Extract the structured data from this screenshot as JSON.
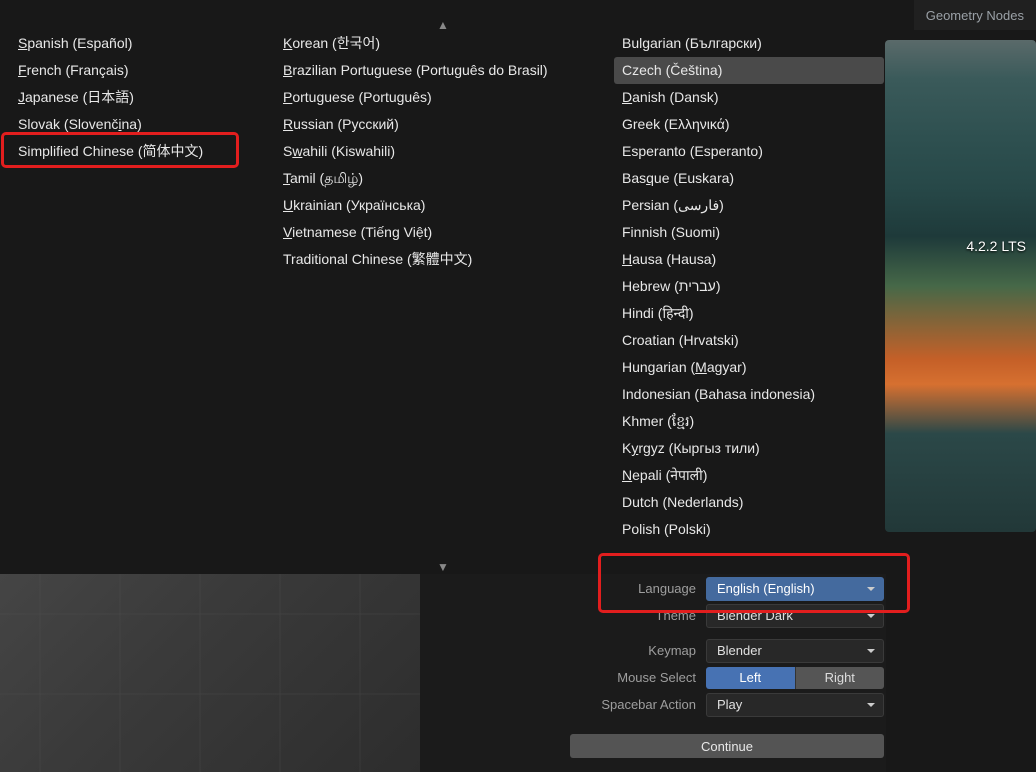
{
  "tabs": {
    "geometry_nodes": "Geometry Nodes"
  },
  "version_label": "4.2.2 LTS",
  "arrows": {
    "up": "▲",
    "down": "▼"
  },
  "languages_col1": [
    {
      "pre": "",
      "ul": "S",
      "post": "panish (Español)"
    },
    {
      "pre": "",
      "ul": "F",
      "post": "rench (Français)"
    },
    {
      "pre": "",
      "ul": "J",
      "post": "apanese (日本語)"
    },
    {
      "pre": "Slovak (Slovenč",
      "ul": "i",
      "post": "na)"
    },
    {
      "pre": "Simplified Chinese (简体中文)",
      "ul": "",
      "post": ""
    }
  ],
  "languages_col2": [
    {
      "pre": "",
      "ul": "K",
      "post": "orean (한국어)"
    },
    {
      "pre": "",
      "ul": "B",
      "post": "razilian Portuguese (Português do Brasil)"
    },
    {
      "pre": "",
      "ul": "P",
      "post": "ortuguese (Português)"
    },
    {
      "pre": "",
      "ul": "R",
      "post": "ussian (Русский)"
    },
    {
      "pre": "S",
      "ul": "w",
      "post": "ahili (Kiswahili)"
    },
    {
      "pre": "",
      "ul": "T",
      "post": "amil (தமிழ்)"
    },
    {
      "pre": "",
      "ul": "U",
      "post": "krainian (Українська)"
    },
    {
      "pre": "",
      "ul": "V",
      "post": "ietnamese (Tiếng Việt)"
    },
    {
      "pre": "Traditional Chinese (繁體中文)",
      "ul": "",
      "post": ""
    }
  ],
  "languages_col3": [
    {
      "pre": "Bulgarian (Български)",
      "ul": "",
      "post": "",
      "hl": false
    },
    {
      "pre": "Czech (Čeština)",
      "ul": "",
      "post": "",
      "hl": true
    },
    {
      "pre": "",
      "ul": "D",
      "post": "anish (Dansk)",
      "hl": false
    },
    {
      "pre": "Greek (Ελληνικά)",
      "ul": "",
      "post": "",
      "hl": false
    },
    {
      "pre": "Esperanto (Esperanto)",
      "ul": "",
      "post": "",
      "hl": false
    },
    {
      "pre": "Bas",
      "ul": "q",
      "post": "ue (Euskara)",
      "hl": false
    },
    {
      "pre": "Persian (فارسی)",
      "ul": "",
      "post": "",
      "hl": false
    },
    {
      "pre": "Finnish (Suomi)",
      "ul": "",
      "post": "",
      "hl": false
    },
    {
      "pre": "",
      "ul": "H",
      "post": "ausa (Hausa)",
      "hl": false
    },
    {
      "pre": "Hebrew (עברית)",
      "ul": "",
      "post": "",
      "hl": false
    },
    {
      "pre": "Hindi (हिन्दी)",
      "ul": "",
      "post": "",
      "hl": false
    },
    {
      "pre": "Croatian (Hrvatski)",
      "ul": "",
      "post": "",
      "hl": false
    },
    {
      "pre": "Hungarian (",
      "ul": "M",
      "post": "agyar)",
      "hl": false
    },
    {
      "pre": "Indonesian (Bahasa indonesia)",
      "ul": "",
      "post": "",
      "hl": false
    },
    {
      "pre": "Khmer (ខ្មែរ)",
      "ul": "",
      "post": "",
      "hl": false
    },
    {
      "pre": "K",
      "ul": "y",
      "post": "rgyz (Кыргыз тили)",
      "hl": false
    },
    {
      "pre": "",
      "ul": "N",
      "post": "epali (नेपाली)",
      "hl": false
    },
    {
      "pre": "Dutch (Nederlands)",
      "ul": "",
      "post": "",
      "hl": false
    },
    {
      "pre": "Polish (Polski)",
      "ul": "",
      "post": "",
      "hl": false
    }
  ],
  "settings": {
    "language": {
      "label": "Language",
      "value": "English (English)"
    },
    "theme": {
      "label": "Theme",
      "value": "Blender Dark"
    },
    "keymap": {
      "label": "Keymap",
      "value": "Blender"
    },
    "mouse": {
      "label": "Mouse Select",
      "left": "Left",
      "right": "Right"
    },
    "spacebar": {
      "label": "Spacebar Action",
      "value": "Play"
    }
  },
  "continue_label": "Continue"
}
